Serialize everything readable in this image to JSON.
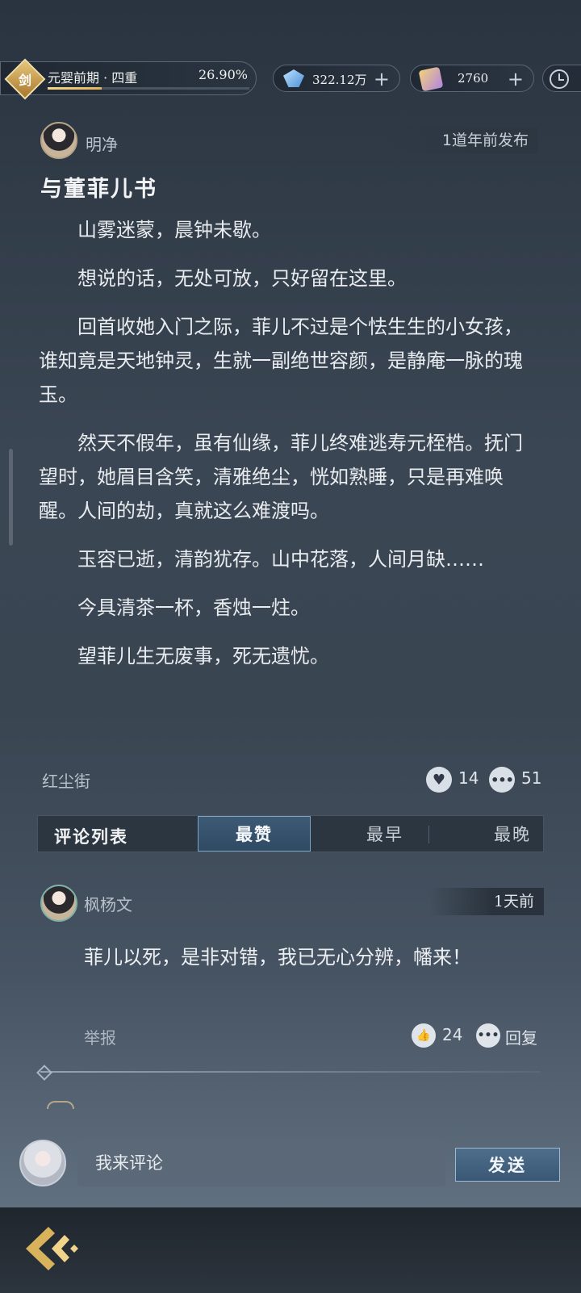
{
  "status_bar": {
    "realm_badge": "剑",
    "realm_name": "元婴前期 · 四重",
    "realm_progress_text": "26.90%",
    "realm_progress_fraction": 0.269,
    "gem_amount": "322.12万",
    "ticket_amount": "2760",
    "plus_symbol": "+",
    "gem_icon": "crystal-icon",
    "ticket_icon": "ticket-icon",
    "clock_icon": "clock-icon"
  },
  "post": {
    "author": "明净",
    "time": "1道年前发布",
    "title": "与董菲儿书",
    "paragraphs": [
      "山雾迷蒙，晨钟未歇。",
      "想说的话，无处可放，只好留在这里。",
      "回首收她入门之际，菲儿不过是个怯生生的小女孩，谁知竟是天地钟灵，生就一副绝世容颜，是静庵一脉的瑰玉。",
      "然天不假年，虽有仙缘，菲儿终难逃寿元桎梏。抚门望时，她眉目含笑，清雅绝尘，恍如熟睡，只是再难唤醒。人间的劫，真就这么难渡吗。",
      "玉容已逝，清韵犹存。山中花落，人间月缺……",
      "今具清茶一杯，香烛一炷。",
      "望菲儿生无废事，死无遗忧。"
    ],
    "location": "红尘街",
    "likes": "14",
    "comments": "51"
  },
  "tabs": {
    "list_label": "评论列表",
    "best": "最赞",
    "earliest": "最早",
    "latest": "最晚",
    "active": "最赞"
  },
  "comment": {
    "author": "枫杨文",
    "time": "1天前",
    "text": "菲儿以死，是非对错，我已无心分辨，幡来！",
    "report": "举报",
    "likes": "24",
    "reply": "回复"
  },
  "input": {
    "placeholder": "我来评论",
    "send_label": "发送"
  },
  "colors": {
    "accent": "#7ea3c4",
    "progress": "#e2b35c"
  }
}
